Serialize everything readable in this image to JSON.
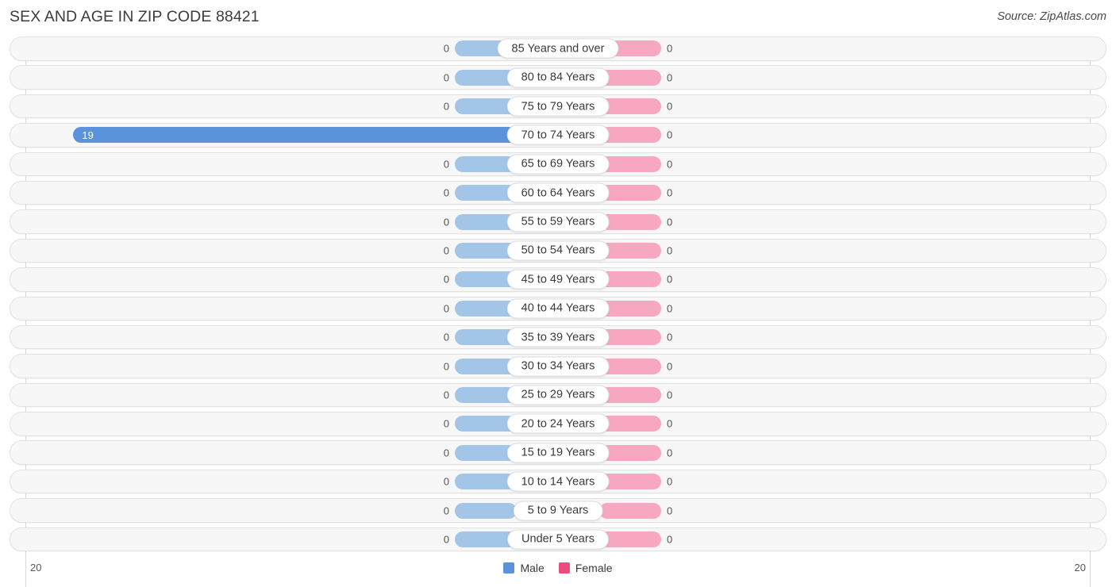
{
  "header": {
    "title": "SEX AND AGE IN ZIP CODE 88421",
    "source": "Source: ZipAtlas.com"
  },
  "axis": {
    "left_label": "20",
    "right_label": "20"
  },
  "legend": {
    "male": {
      "label": "Male",
      "color": "#5b92dc"
    },
    "female": {
      "label": "Female",
      "color": "#ec4c7e"
    }
  },
  "colors": {
    "male_bar": "#a3c6e8",
    "female_bar": "#f7a8c0",
    "male_highlight": "#5b92dc",
    "female_highlight": "#ec4c7e",
    "row_track": "#f7f7f7",
    "row_border": "#e2e2e2",
    "gridline": "#d8d8d8"
  },
  "chart_data": {
    "type": "bar",
    "title": "SEX AND AGE IN ZIP CODE 88421",
    "subtitle": "Source: ZipAtlas.com",
    "orientation": "horizontal",
    "layout": "population-pyramid",
    "xlabel": "",
    "ylabel": "",
    "xlim": [
      0,
      20
    ],
    "axis_max": 20,
    "grid": false,
    "legend_position": "bottom-center",
    "categories": [
      "85 Years and over",
      "80 to 84 Years",
      "75 to 79 Years",
      "70 to 74 Years",
      "65 to 69 Years",
      "60 to 64 Years",
      "55 to 59 Years",
      "50 to 54 Years",
      "45 to 49 Years",
      "40 to 44 Years",
      "35 to 39 Years",
      "30 to 34 Years",
      "25 to 29 Years",
      "20 to 24 Years",
      "15 to 19 Years",
      "10 to 14 Years",
      "5 to 9 Years",
      "Under 5 Years"
    ],
    "series": [
      {
        "name": "Male",
        "color": "#5b92dc",
        "values": [
          0,
          0,
          0,
          19,
          0,
          0,
          0,
          0,
          0,
          0,
          0,
          0,
          0,
          0,
          0,
          0,
          0,
          0
        ]
      },
      {
        "name": "Female",
        "color": "#ec4c7e",
        "values": [
          0,
          0,
          0,
          0,
          0,
          0,
          0,
          0,
          0,
          0,
          0,
          0,
          0,
          0,
          0,
          0,
          0,
          0
        ]
      }
    ]
  },
  "rows": [
    {
      "age": "85 Years and over",
      "male": "0",
      "female": "0"
    },
    {
      "age": "80 to 84 Years",
      "male": "0",
      "female": "0"
    },
    {
      "age": "75 to 79 Years",
      "male": "0",
      "female": "0"
    },
    {
      "age": "70 to 74 Years",
      "male": "19",
      "female": "0"
    },
    {
      "age": "65 to 69 Years",
      "male": "0",
      "female": "0"
    },
    {
      "age": "60 to 64 Years",
      "male": "0",
      "female": "0"
    },
    {
      "age": "55 to 59 Years",
      "male": "0",
      "female": "0"
    },
    {
      "age": "50 to 54 Years",
      "male": "0",
      "female": "0"
    },
    {
      "age": "45 to 49 Years",
      "male": "0",
      "female": "0"
    },
    {
      "age": "40 to 44 Years",
      "male": "0",
      "female": "0"
    },
    {
      "age": "35 to 39 Years",
      "male": "0",
      "female": "0"
    },
    {
      "age": "30 to 34 Years",
      "male": "0",
      "female": "0"
    },
    {
      "age": "25 to 29 Years",
      "male": "0",
      "female": "0"
    },
    {
      "age": "20 to 24 Years",
      "male": "0",
      "female": "0"
    },
    {
      "age": "15 to 19 Years",
      "male": "0",
      "female": "0"
    },
    {
      "age": "10 to 14 Years",
      "male": "0",
      "female": "0"
    },
    {
      "age": "5 to 9 Years",
      "male": "0",
      "female": "0"
    },
    {
      "age": "Under 5 Years",
      "male": "0",
      "female": "0"
    }
  ]
}
